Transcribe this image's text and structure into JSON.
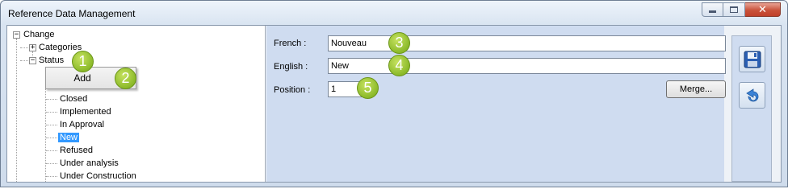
{
  "window": {
    "title": "Reference Data Management"
  },
  "tree": {
    "root": {
      "label": "Change",
      "expander": "−"
    },
    "categories": {
      "label": "Categories",
      "expander": "+"
    },
    "status": {
      "label": "Status",
      "expander": "−"
    },
    "items": [
      "Closed",
      "Implemented",
      "In Approval",
      "New",
      "Refused",
      "Under analysis",
      "Under Construction"
    ],
    "selected_item": "New"
  },
  "context_menu": {
    "add_label": "Add"
  },
  "badges": [
    "1",
    "2",
    "3",
    "4",
    "5"
  ],
  "form": {
    "french_label": "French :",
    "french_value": "Nouveau",
    "english_label": "English :",
    "english_value": "New",
    "position_label": "Position :",
    "position_value": "1",
    "merge_label": "Merge..."
  },
  "toolbar": {
    "save_icon": "floppy-disk-save-icon",
    "undo_icon": "undo-arrow-icon"
  },
  "colors": {
    "selection": "#3399ff",
    "badge": "#8cba2a",
    "form_background": "#cfdcf0"
  }
}
